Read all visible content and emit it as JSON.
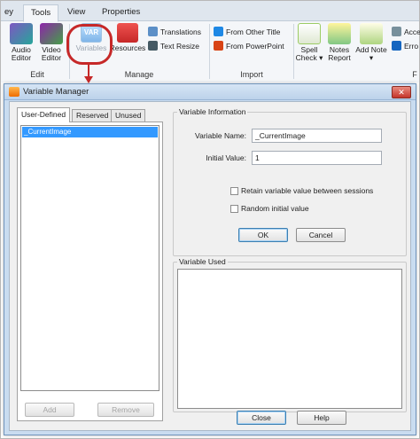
{
  "ribbon": {
    "tabs": [
      {
        "label": "ey"
      },
      {
        "label": "Tools"
      },
      {
        "label": "View"
      },
      {
        "label": "Properties"
      }
    ],
    "edit": {
      "audio_editor": "Audio Editor",
      "video_editor": "Video Editor",
      "label": "Edit"
    },
    "manage": {
      "variables": "Variables",
      "resources": "Resources",
      "translations": "Translations",
      "text_resize": "Text Resize",
      "label": "Manage"
    },
    "import": {
      "from_other_title": "From Other Title",
      "from_powerpoint": "From PowerPoint",
      "label": "Import"
    },
    "proof": {
      "spell_check": "Spell Check ▾",
      "notes_report": "Notes Report",
      "add_note": "Add Note ▾",
      "acc": "Acce",
      "erro": "Erro",
      "group_letter": "F"
    }
  },
  "dialog": {
    "title": "Variable Manager",
    "close_glyph": "✕",
    "tabs": [
      {
        "label": "User-Defined"
      },
      {
        "label": "Reserved"
      },
      {
        "label": "Unused"
      }
    ],
    "variables": [
      "_CurrentImage"
    ],
    "add_label": "Add",
    "remove_label": "Remove",
    "info": {
      "legend": "Variable Information",
      "name_label": "Variable Name:",
      "name_value": "_CurrentImage",
      "initial_label": "Initial Value:",
      "initial_value": "1",
      "retain_label": "Retain variable value between sessions",
      "random_label": "Random initial value",
      "ok_label": "OK",
      "cancel_label": "Cancel"
    },
    "used": {
      "legend": "Variable Used"
    },
    "close_label": "Close",
    "help_label": "Help"
  },
  "colors": {
    "highlight": "#c62828",
    "selection": "#3399ff",
    "titlebar": "#bcd2ea"
  }
}
